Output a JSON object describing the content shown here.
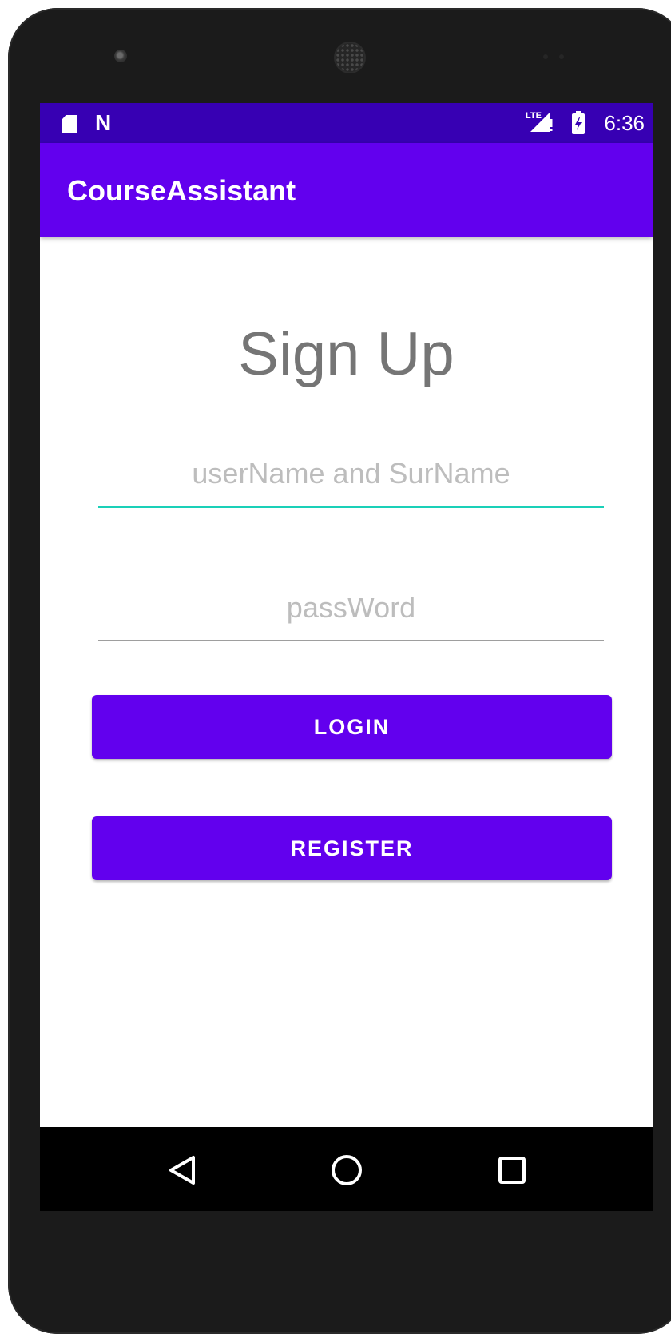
{
  "status_bar": {
    "network_label": "LTE",
    "time": "6:36",
    "notification_icons": [
      "sd-card-icon",
      "n-icon"
    ],
    "n_glyph": "N"
  },
  "app_bar": {
    "title": "CourseAssistant",
    "color": "#6200ee",
    "status_color": "#3700b3"
  },
  "form": {
    "heading": "Sign Up",
    "username": {
      "value": "",
      "placeholder": "userName and SurName"
    },
    "password": {
      "value": "",
      "placeholder": "passWord"
    },
    "login_label": "LOGIN",
    "register_label": "REGISTER",
    "focus_color": "#1ad0b8"
  },
  "nav_bar": {
    "items": [
      "back-icon",
      "home-icon",
      "recents-icon"
    ]
  }
}
